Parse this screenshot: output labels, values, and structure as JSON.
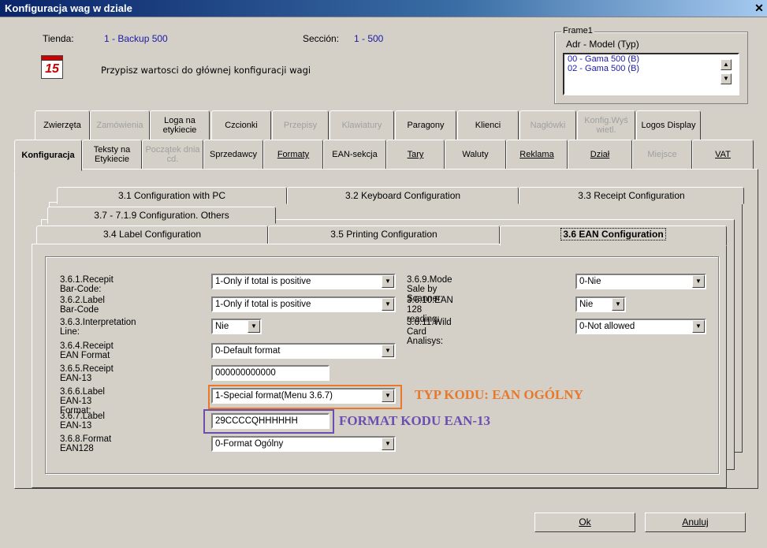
{
  "window": {
    "title": "Konfiguracja wag w dziale",
    "close": "✕"
  },
  "header": {
    "tienda_label": "Tienda:",
    "tienda_value": "1 - Backup 500",
    "seccion_label": "Sección:",
    "seccion_value": "1 - 500",
    "hint": "Przypisz wartosci do głównej konfiguracji wagi",
    "calendar_icon": "calendar-icon",
    "calendar_number": "15"
  },
  "frame": {
    "legend": "Frame1",
    "subtitle": "Adr - Model (Typ)",
    "items": [
      "00 - Gama 500 (B)",
      "02 - Gama 500 (B)"
    ]
  },
  "tabs_row1": [
    {
      "label": "Zwierzęta",
      "disabled": false
    },
    {
      "label": "Zamówienia",
      "disabled": true
    },
    {
      "label": "Loga na etykiecie",
      "disabled": false
    },
    {
      "label": "Czcionki",
      "disabled": false
    },
    {
      "label": "Przepisy",
      "disabled": true
    },
    {
      "label": "Klawiatury",
      "disabled": true
    },
    {
      "label": "Paragony",
      "disabled": false
    },
    {
      "label": "Klienci",
      "disabled": false
    },
    {
      "label": "Nagłówki",
      "disabled": true
    },
    {
      "label": "Konfig.Wyś wietl.",
      "disabled": true
    },
    {
      "label": "Logos Display",
      "disabled": false
    }
  ],
  "tabs_row2": [
    {
      "label": "Konfiguracja",
      "active": true
    },
    {
      "label": "Teksty na Etykiecie"
    },
    {
      "label": "Początek dnia cd.",
      "disabled": true
    },
    {
      "label": "Sprzedawcy"
    },
    {
      "label": "Formaty"
    },
    {
      "label": "EAN-sekcja"
    },
    {
      "label": "Tary"
    },
    {
      "label": "Waluty"
    },
    {
      "label": "Reklama"
    },
    {
      "label": "Dział"
    },
    {
      "label": "Miejsce",
      "disabled": true
    },
    {
      "label": "VAT"
    }
  ],
  "subtabs": {
    "t31": "3.1 Configuration with PC",
    "t32": "3.2 Keyboard Configuration",
    "t33": "3.3 Receipt Configuration",
    "t37": "3.7 - 7.1.9 Configuration. Others",
    "t34": "3.4 Label Configuration",
    "t35": "3.5 Printing Configuration",
    "t36": "3.6 EAN Configuration"
  },
  "fields": {
    "f361_label": "3.6.1.Recepit Bar-Code:",
    "f361_value": "1-Only if total is positive",
    "f362_label": "3.6.2.Label Bar-Code",
    "f362_value": "1-Only if total is positive",
    "f363_label": "3.6.3.Interpretation Line:",
    "f363_value": "Nie",
    "f364_label": "3.6.4.Receipt EAN Format",
    "f364_value": "0-Default format",
    "f365_label": "3.6.5.Receipt EAN-13",
    "f365_value": "000000000000",
    "f366_label": "3.6.6.Label EAN-13 Format:",
    "f366_value": "1-Special format(Menu 3.6.7)",
    "f367_label": "3.6.7.Label EAN-13",
    "f367_value": "29CCCCQHHHHHH",
    "f368_label": "3.6.8.Format EAN128",
    "f368_value": "0-Format Ogólny",
    "f369_label": "3.6.9.Mode Sale by Scanner:",
    "f369_value": "0-Nie",
    "f3610_label": "3.6.10.EAN 128 reading:",
    "f3610_value": "Nie",
    "f3611_label": "3.6.11.Wild Card Analisys:",
    "f3611_value": "0-Not allowed"
  },
  "annotations": {
    "typ_kodu": "TYP KODU: EAN OGÓLNY",
    "format_kodu": "FORMAT KODU EAN-13",
    "orange": "#e8782a",
    "purple": "#6b4fb0"
  },
  "buttons": {
    "ok": "Ok",
    "cancel": "Anuluj"
  }
}
